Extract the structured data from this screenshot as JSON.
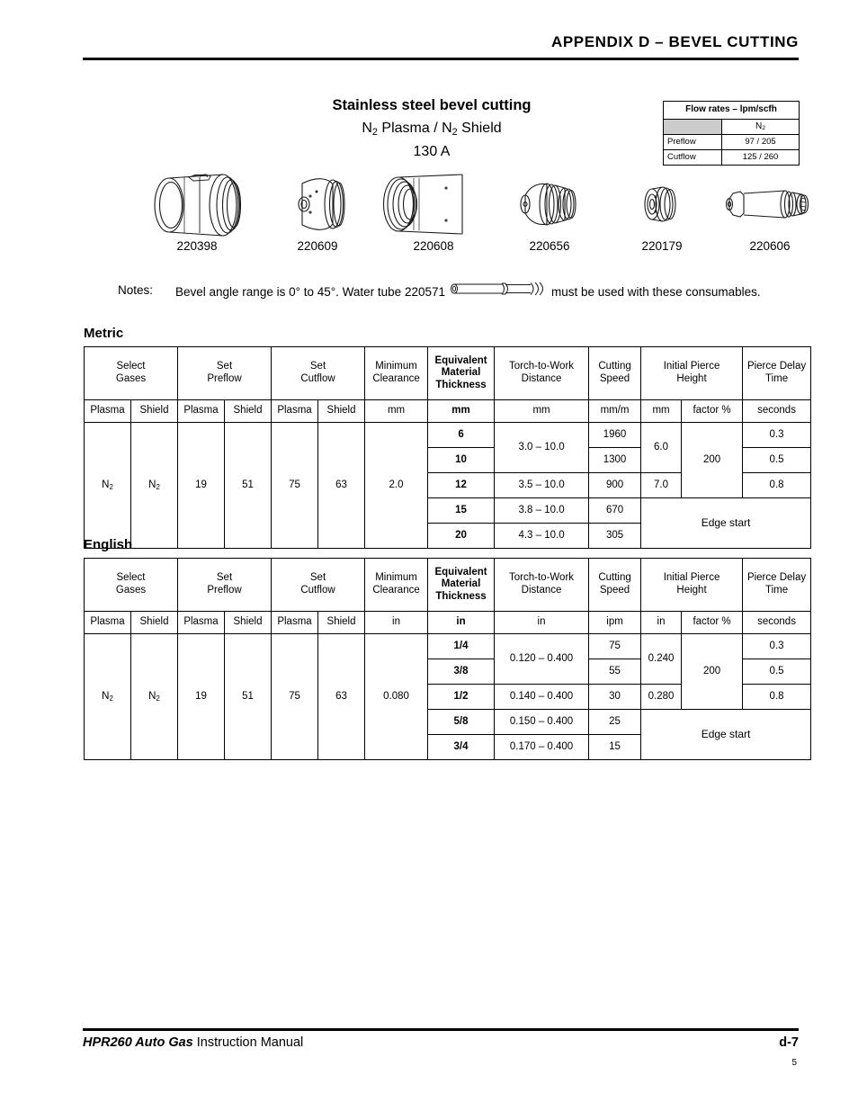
{
  "header": {
    "title": "APPENDIX D  –  BEVEL CUTTING"
  },
  "title_block": {
    "line1": "Stainless steel bevel cutting",
    "line2_pre": "N",
    "line2_sub1": "2",
    "line2_mid": " Plasma / N",
    "line2_sub2": "2",
    "line2_post": " Shield",
    "line3": "130 A"
  },
  "flow_rates": {
    "title": "Flow rates  –  lpm/scfh",
    "gas_label": "N",
    "gas_sub": "2",
    "rows": [
      {
        "label": "Preflow",
        "value": "97 / 205"
      },
      {
        "label": "Cutflow",
        "value": "125 / 260"
      }
    ]
  },
  "consumables": [
    {
      "part": "220398",
      "icon": "shield-cap-icon"
    },
    {
      "part": "220609",
      "icon": "shield-cone-icon"
    },
    {
      "part": "220608",
      "icon": "retaining-cap-icon"
    },
    {
      "part": "220656",
      "icon": "nozzle-icon"
    },
    {
      "part": "220179",
      "icon": "swirl-ring-icon"
    },
    {
      "part": "220606",
      "icon": "electrode-icon"
    }
  ],
  "notes": {
    "label": "Notes:",
    "text_before": "Bevel angle range is 0° to 45°. Water tube 220571",
    "text_after": "must be used with these consumables."
  },
  "sections": {
    "metric_label": "Metric",
    "english_label": "English"
  },
  "table_headers": {
    "select_gases": "Select\nGases",
    "set_preflow": "Set\nPreflow",
    "set_cutflow": "Set\nCutflow",
    "minimum_clearance": "Minimum\nClearance",
    "equivalent_material_thickness": "Equivalent\nMaterial\nThickness",
    "torch_to_work_distance": "Torch-to-Work\nDistance",
    "cutting_speed": "Cutting\nSpeed",
    "initial_pierce_height": "Initial Pierce\nHeight",
    "pierce_delay_time": "Pierce Delay\nTime",
    "plasma": "Plasma",
    "shield": "Shield"
  },
  "metric": {
    "units": {
      "plasma1": "Plasma",
      "shield1": "Shield",
      "plasma2": "Plasma",
      "shield2": "Shield",
      "plasma3": "Plasma",
      "shield3": "Shield",
      "clearance": "mm",
      "thickness": "mm",
      "ttw": "mm",
      "speed": "mm/m",
      "iph_mm": "mm",
      "iph_factor": "factor %",
      "delay": "seconds"
    },
    "gases": {
      "plasma": "N",
      "plasma_sub": "2",
      "shield": "N",
      "shield_sub": "2"
    },
    "preflow": {
      "plasma": "19",
      "shield": "51"
    },
    "cutflow": {
      "plasma": "75",
      "shield": "63"
    },
    "clearance": "2.0",
    "edge_start": "Edge start",
    "factor": "200",
    "rows": [
      {
        "thickness": "6",
        "ttw": "3.0 – 10.0",
        "speed": "1960",
        "iph": "6.0",
        "delay": "0.3"
      },
      {
        "thickness": "10",
        "ttw": "",
        "speed": "1300",
        "iph": "",
        "delay": "0.5"
      },
      {
        "thickness": "12",
        "ttw": "3.5 – 10.0",
        "speed": "900",
        "iph": "7.0",
        "delay": "0.8"
      },
      {
        "thickness": "15",
        "ttw": "3.8 – 10.0",
        "speed": "670",
        "iph": "",
        "delay": ""
      },
      {
        "thickness": "20",
        "ttw": "4.3 – 10.0",
        "speed": "305",
        "iph": "",
        "delay": ""
      }
    ]
  },
  "english": {
    "units": {
      "plasma1": "Plasma",
      "shield1": "Shield",
      "plasma2": "Plasma",
      "shield2": "Shield",
      "plasma3": "Plasma",
      "shield3": "Shield",
      "clearance": "in",
      "thickness": "in",
      "ttw": "in",
      "speed": "ipm",
      "iph_mm": "in",
      "iph_factor": "factor %",
      "delay": "seconds"
    },
    "gases": {
      "plasma": "N",
      "plasma_sub": "2",
      "shield": "N",
      "shield_sub": "2"
    },
    "preflow": {
      "plasma": "19",
      "shield": "51"
    },
    "cutflow": {
      "plasma": "75",
      "shield": "63"
    },
    "clearance": "0.080",
    "edge_start": "Edge start",
    "factor": "200",
    "rows": [
      {
        "thickness": "1/4",
        "ttw": "0.120 – 0.400",
        "speed": "75",
        "iph": "0.240",
        "delay": "0.3"
      },
      {
        "thickness": "3/8",
        "ttw": "",
        "speed": "55",
        "iph": "",
        "delay": "0.5"
      },
      {
        "thickness": "1/2",
        "ttw": "0.140 – 0.400",
        "speed": "30",
        "iph": "0.280",
        "delay": "0.8"
      },
      {
        "thickness": "5/8",
        "ttw": "0.150 – 0.400",
        "speed": "25",
        "iph": "",
        "delay": ""
      },
      {
        "thickness": "3/4",
        "ttw": "0.170 – 0.400",
        "speed": "15",
        "iph": "",
        "delay": ""
      }
    ]
  },
  "footer": {
    "brand": "HPR260 Auto Gas",
    "manual": " Instruction Manual",
    "page": "d-7",
    "sheet": "5"
  }
}
